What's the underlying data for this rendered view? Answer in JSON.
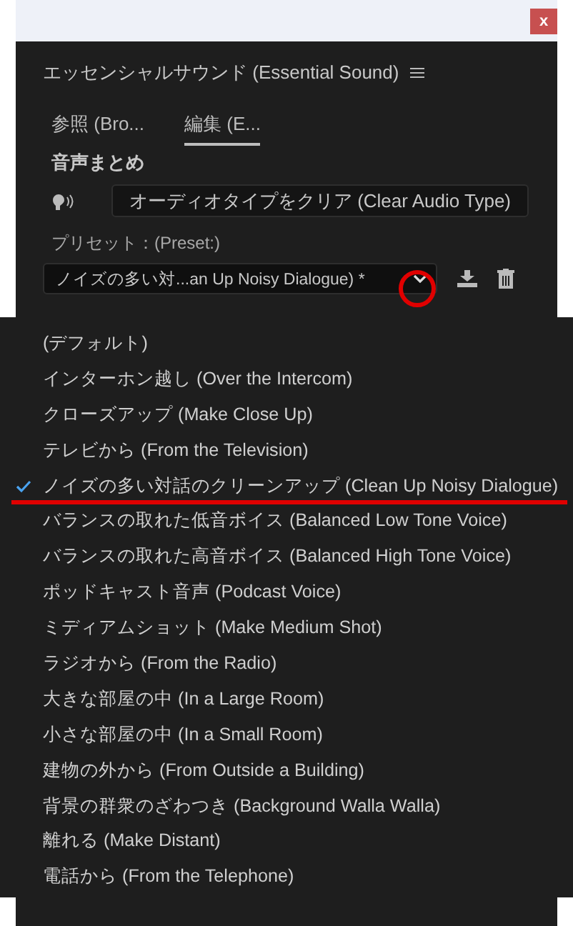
{
  "window": {
    "close": "x"
  },
  "panel": {
    "title": "エッセンシャルサウンド (Essential Sound)",
    "tabs": [
      {
        "label": "参照 (Bro...",
        "selected": false
      },
      {
        "label": "編集 (E...",
        "selected": true
      }
    ],
    "section": "音声まとめ",
    "clear_button": "オーディオタイプをクリア (Clear Audio Type)",
    "preset_label": "プリセット：(Preset:)",
    "preset_value": "ノイズの多い対...an Up Noisy Dialogue) *"
  },
  "dropdown": {
    "items": [
      {
        "label": "(デフォルト)",
        "selected": false
      },
      {
        "label": "インターホン越し (Over the Intercom)",
        "selected": false
      },
      {
        "label": "クローズアップ (Make Close Up)",
        "selected": false
      },
      {
        "label": "テレビから (From the Television)",
        "selected": false
      },
      {
        "label": "ノイズの多い対話のクリーンアップ (Clean Up Noisy Dialogue)",
        "selected": true
      },
      {
        "label": "バランスの取れた低音ボイス (Balanced Low Tone Voice)",
        "selected": false
      },
      {
        "label": "バランスの取れた高音ボイス (Balanced High Tone Voice)",
        "selected": false
      },
      {
        "label": "ポッドキャスト音声 (Podcast Voice)",
        "selected": false
      },
      {
        "label": "ミディアムショット (Make Medium Shot)",
        "selected": false
      },
      {
        "label": "ラジオから (From the Radio)",
        "selected": false
      },
      {
        "label": "大きな部屋の中 (In a Large Room)",
        "selected": false
      },
      {
        "label": "小さな部屋の中 (In a Small Room)",
        "selected": false
      },
      {
        "label": "建物の外から (From Outside a Building)",
        "selected": false
      },
      {
        "label": "背景の群衆のざわつき (Background Walla Walla)",
        "selected": false
      },
      {
        "label": "離れる (Make Distant)",
        "selected": false
      },
      {
        "label": "電話から (From the Telephone)",
        "selected": false
      }
    ]
  }
}
